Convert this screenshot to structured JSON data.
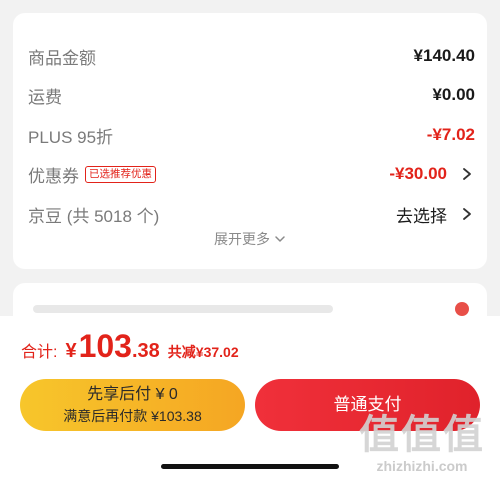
{
  "summary": {
    "rows": [
      {
        "label": "商品金额",
        "value": "¥140.40"
      },
      {
        "label": "运费",
        "value": "¥0.00"
      },
      {
        "label": "PLUS 95折",
        "value": "-¥7.02"
      },
      {
        "label": "优惠券",
        "badge": "已选推荐优惠",
        "value": "-¥30.00"
      },
      {
        "label": "京豆 (共 5018 个)",
        "value": "去选择"
      }
    ],
    "expand_label": "展开更多"
  },
  "checkout": {
    "total_label": "合计:",
    "currency": "¥",
    "total_integer": "103",
    "total_decimal": ".38",
    "saved": "共减¥37.02",
    "pay_later_main": "先享后付 ¥ 0",
    "pay_later_sub": "满意后再付款 ¥103.38",
    "pay_now": "普通支付"
  },
  "watermark": {
    "logo": "值值值",
    "text": "zhizhizhi.com"
  },
  "colors": {
    "accent_red": "#e2231a",
    "pay_later_yellow": "#f7c62b",
    "pay_now_red": "#f0303a"
  }
}
